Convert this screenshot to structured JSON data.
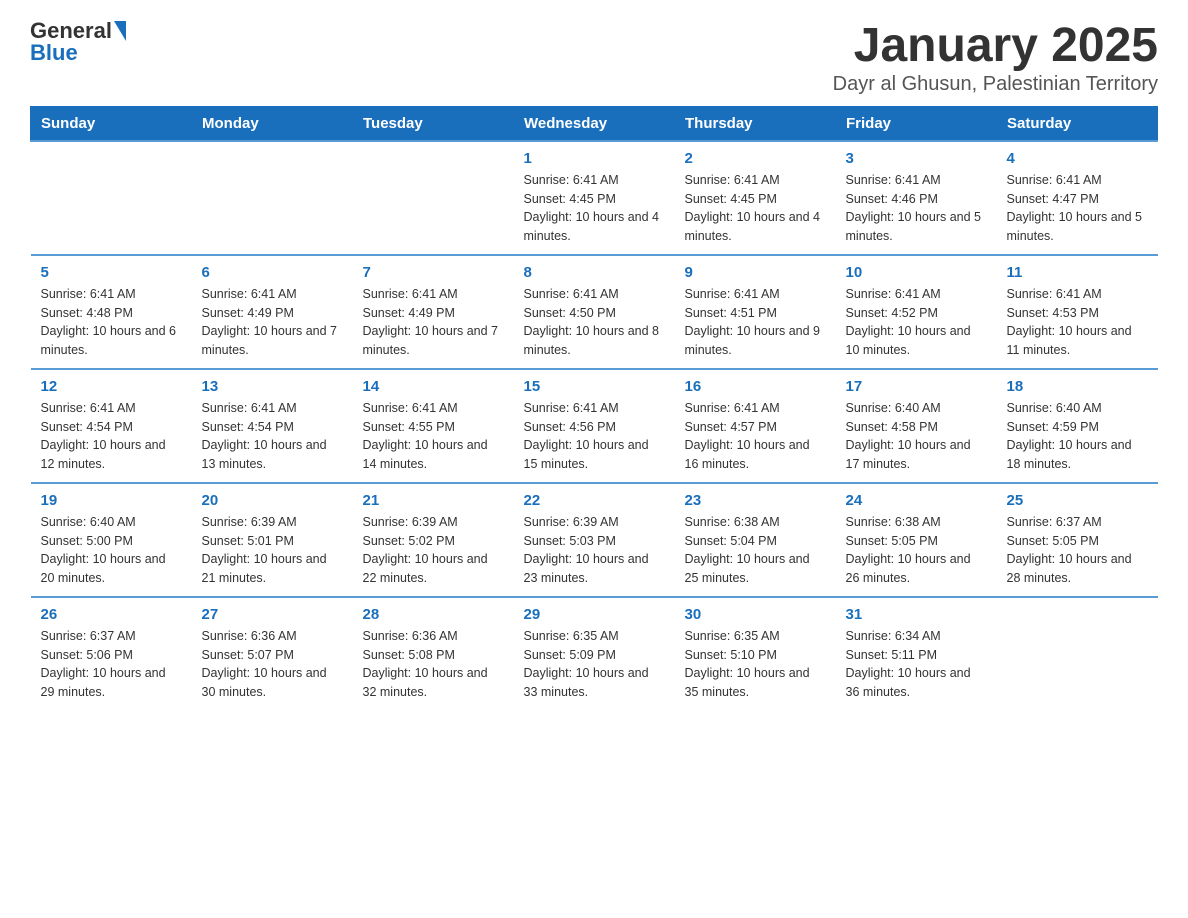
{
  "logo": {
    "general": "General",
    "blue": "Blue"
  },
  "title": "January 2025",
  "subtitle": "Dayr al Ghusun, Palestinian Territory",
  "weekdays": [
    "Sunday",
    "Monday",
    "Tuesday",
    "Wednesday",
    "Thursday",
    "Friday",
    "Saturday"
  ],
  "weeks": [
    [
      {
        "day": "",
        "info": ""
      },
      {
        "day": "",
        "info": ""
      },
      {
        "day": "",
        "info": ""
      },
      {
        "day": "1",
        "info": "Sunrise: 6:41 AM\nSunset: 4:45 PM\nDaylight: 10 hours\nand 4 minutes."
      },
      {
        "day": "2",
        "info": "Sunrise: 6:41 AM\nSunset: 4:45 PM\nDaylight: 10 hours\nand 4 minutes."
      },
      {
        "day": "3",
        "info": "Sunrise: 6:41 AM\nSunset: 4:46 PM\nDaylight: 10 hours\nand 5 minutes."
      },
      {
        "day": "4",
        "info": "Sunrise: 6:41 AM\nSunset: 4:47 PM\nDaylight: 10 hours\nand 5 minutes."
      }
    ],
    [
      {
        "day": "5",
        "info": "Sunrise: 6:41 AM\nSunset: 4:48 PM\nDaylight: 10 hours\nand 6 minutes."
      },
      {
        "day": "6",
        "info": "Sunrise: 6:41 AM\nSunset: 4:49 PM\nDaylight: 10 hours\nand 7 minutes."
      },
      {
        "day": "7",
        "info": "Sunrise: 6:41 AM\nSunset: 4:49 PM\nDaylight: 10 hours\nand 7 minutes."
      },
      {
        "day": "8",
        "info": "Sunrise: 6:41 AM\nSunset: 4:50 PM\nDaylight: 10 hours\nand 8 minutes."
      },
      {
        "day": "9",
        "info": "Sunrise: 6:41 AM\nSunset: 4:51 PM\nDaylight: 10 hours\nand 9 minutes."
      },
      {
        "day": "10",
        "info": "Sunrise: 6:41 AM\nSunset: 4:52 PM\nDaylight: 10 hours\nand 10 minutes."
      },
      {
        "day": "11",
        "info": "Sunrise: 6:41 AM\nSunset: 4:53 PM\nDaylight: 10 hours\nand 11 minutes."
      }
    ],
    [
      {
        "day": "12",
        "info": "Sunrise: 6:41 AM\nSunset: 4:54 PM\nDaylight: 10 hours\nand 12 minutes."
      },
      {
        "day": "13",
        "info": "Sunrise: 6:41 AM\nSunset: 4:54 PM\nDaylight: 10 hours\nand 13 minutes."
      },
      {
        "day": "14",
        "info": "Sunrise: 6:41 AM\nSunset: 4:55 PM\nDaylight: 10 hours\nand 14 minutes."
      },
      {
        "day": "15",
        "info": "Sunrise: 6:41 AM\nSunset: 4:56 PM\nDaylight: 10 hours\nand 15 minutes."
      },
      {
        "day": "16",
        "info": "Sunrise: 6:41 AM\nSunset: 4:57 PM\nDaylight: 10 hours\nand 16 minutes."
      },
      {
        "day": "17",
        "info": "Sunrise: 6:40 AM\nSunset: 4:58 PM\nDaylight: 10 hours\nand 17 minutes."
      },
      {
        "day": "18",
        "info": "Sunrise: 6:40 AM\nSunset: 4:59 PM\nDaylight: 10 hours\nand 18 minutes."
      }
    ],
    [
      {
        "day": "19",
        "info": "Sunrise: 6:40 AM\nSunset: 5:00 PM\nDaylight: 10 hours\nand 20 minutes."
      },
      {
        "day": "20",
        "info": "Sunrise: 6:39 AM\nSunset: 5:01 PM\nDaylight: 10 hours\nand 21 minutes."
      },
      {
        "day": "21",
        "info": "Sunrise: 6:39 AM\nSunset: 5:02 PM\nDaylight: 10 hours\nand 22 minutes."
      },
      {
        "day": "22",
        "info": "Sunrise: 6:39 AM\nSunset: 5:03 PM\nDaylight: 10 hours\nand 23 minutes."
      },
      {
        "day": "23",
        "info": "Sunrise: 6:38 AM\nSunset: 5:04 PM\nDaylight: 10 hours\nand 25 minutes."
      },
      {
        "day": "24",
        "info": "Sunrise: 6:38 AM\nSunset: 5:05 PM\nDaylight: 10 hours\nand 26 minutes."
      },
      {
        "day": "25",
        "info": "Sunrise: 6:37 AM\nSunset: 5:05 PM\nDaylight: 10 hours\nand 28 minutes."
      }
    ],
    [
      {
        "day": "26",
        "info": "Sunrise: 6:37 AM\nSunset: 5:06 PM\nDaylight: 10 hours\nand 29 minutes."
      },
      {
        "day": "27",
        "info": "Sunrise: 6:36 AM\nSunset: 5:07 PM\nDaylight: 10 hours\nand 30 minutes."
      },
      {
        "day": "28",
        "info": "Sunrise: 6:36 AM\nSunset: 5:08 PM\nDaylight: 10 hours\nand 32 minutes."
      },
      {
        "day": "29",
        "info": "Sunrise: 6:35 AM\nSunset: 5:09 PM\nDaylight: 10 hours\nand 33 minutes."
      },
      {
        "day": "30",
        "info": "Sunrise: 6:35 AM\nSunset: 5:10 PM\nDaylight: 10 hours\nand 35 minutes."
      },
      {
        "day": "31",
        "info": "Sunrise: 6:34 AM\nSunset: 5:11 PM\nDaylight: 10 hours\nand 36 minutes."
      },
      {
        "day": "",
        "info": ""
      }
    ]
  ]
}
